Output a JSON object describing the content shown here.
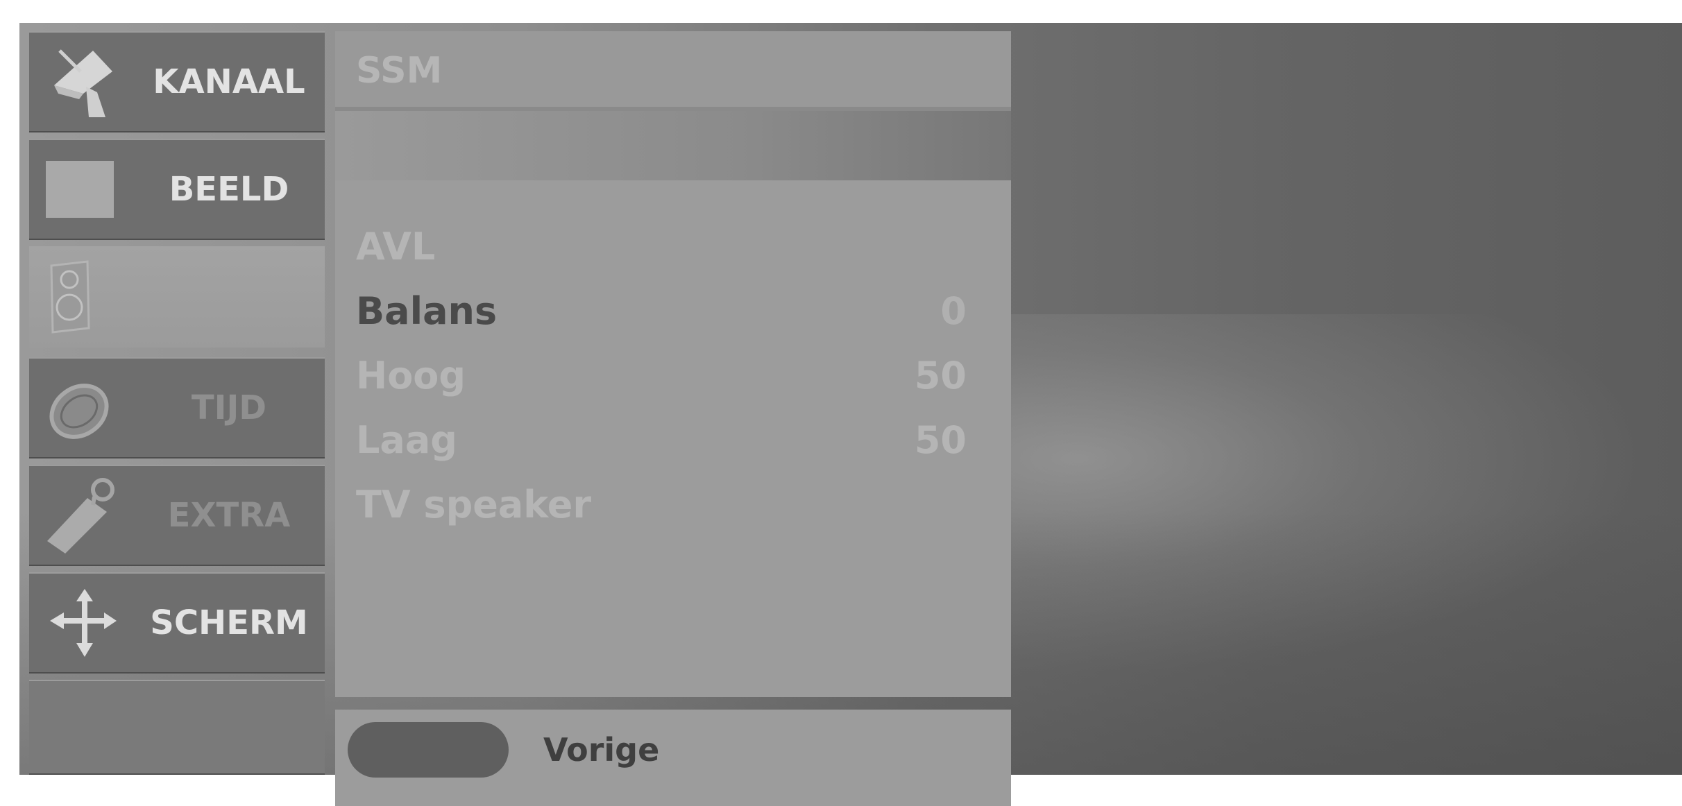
{
  "sidebar": {
    "items": [
      {
        "label": "KANAAL",
        "icon": "satellite-dish-icon"
      },
      {
        "label": "BEELD",
        "icon": "picture-square-icon"
      },
      {
        "label": "",
        "icon": "speaker-icon"
      },
      {
        "label": "TIJD",
        "icon": "clock-icon"
      },
      {
        "label": "EXTRA",
        "icon": "tag-icon"
      },
      {
        "label": "SCHERM",
        "icon": "move-arrows-icon"
      }
    ]
  },
  "panel": {
    "header_title": "SSM",
    "rows": [
      {
        "label": "AVL",
        "value": ""
      },
      {
        "label": "Balans",
        "value": "0"
      },
      {
        "label": "Hoog",
        "value": "50"
      },
      {
        "label": "Laag",
        "value": "50"
      },
      {
        "label": "TV speaker",
        "value": ""
      }
    ],
    "footer_label": "Vorige"
  },
  "colors": {
    "menu_active_text": "#4a4a4a",
    "menu_dim_text": "#b5b5b5",
    "sidebar_label": "#e3e3e3"
  }
}
